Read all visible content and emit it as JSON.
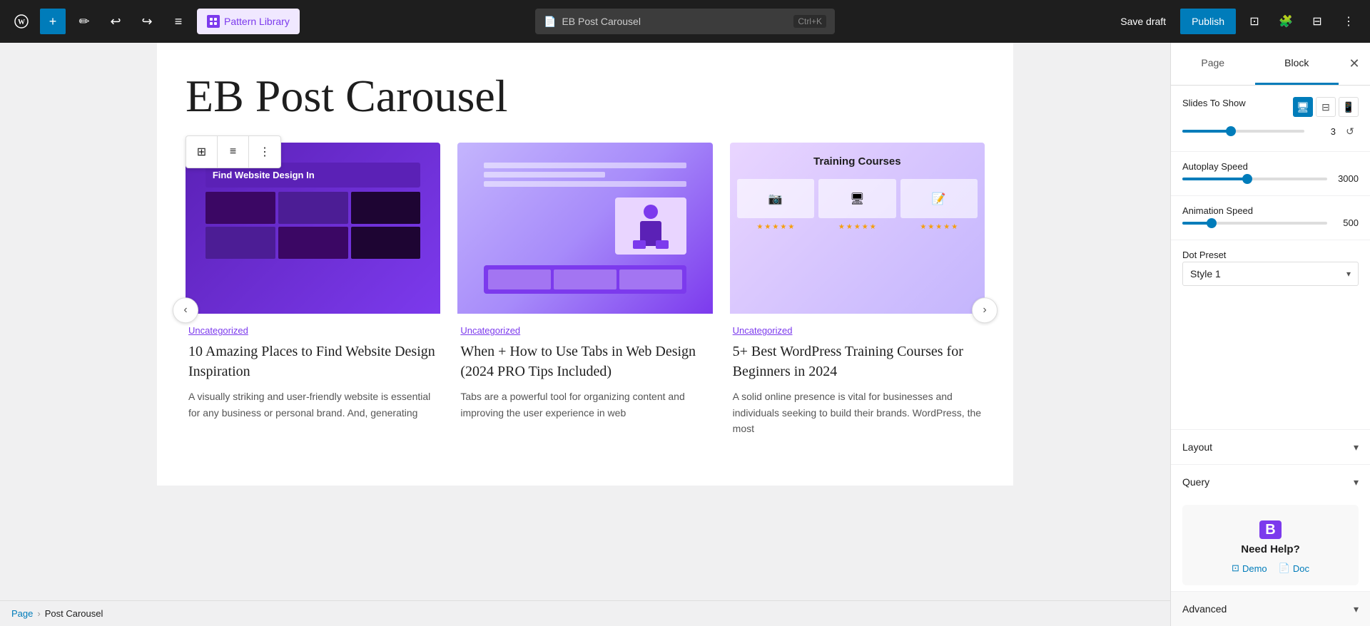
{
  "topbar": {
    "wp_logo": "W",
    "add_label": "+",
    "edit_icon": "✏",
    "undo_icon": "↩",
    "redo_icon": "↪",
    "menu_icon": "≡",
    "pattern_library_label": "Pattern Library",
    "pattern_library_icon": "B",
    "search_placeholder": "EB Post Carousel",
    "search_shortcut": "Ctrl+K",
    "save_draft_label": "Save draft",
    "publish_label": "Publish",
    "view_icon": "⊡",
    "settings_icon": "⊟",
    "puzzle_icon": "⊞",
    "more_icon": "⋮"
  },
  "editor": {
    "page_title": "EB Post Carousel",
    "block_toolbar": {
      "grid_icon": "⊞",
      "list_icon": "≡",
      "more_icon": "⋮"
    }
  },
  "carousel": {
    "prev_icon": "‹",
    "next_icon": "›",
    "cards": [
      {
        "category": "Uncategorized",
        "title": "10 Amazing Places to Find Website Design Inspiration",
        "excerpt": "A visually striking and user-friendly website is essential for any business or personal brand. And, generating",
        "card_label": "Find Website Design In"
      },
      {
        "category": "Uncategorized",
        "title": "When + How to Use Tabs in Web Design (2024 PRO Tips Included)",
        "excerpt": "Tabs are a powerful tool for organizing content and improving the user experience in web"
      },
      {
        "category": "Uncategorized",
        "title": "5+ Best WordPress Training Courses for Beginners in 2024",
        "excerpt": "A solid online presence is vital for businesses and individuals seeking to build their brands. WordPress, the most",
        "card3_title": "Training Courses"
      }
    ]
  },
  "breadcrumb": {
    "page_label": "Page",
    "sep": "›",
    "current": "Post Carousel"
  },
  "sidebar": {
    "page_tab": "Page",
    "block_tab": "Block",
    "close_icon": "✕",
    "slides_to_show_label": "Slides To Show",
    "slides_to_show_value": "3",
    "slides_slider_percent": 40,
    "autoplay_speed_label": "Autoplay Speed",
    "autoplay_speed_value": "3000",
    "autoplay_slider_percent": 45,
    "animation_speed_label": "Animation Speed",
    "animation_speed_value": "500",
    "animation_slider_percent": 20,
    "dot_preset_label": "Dot Preset",
    "dot_preset_value": "Style 1",
    "dot_preset_chevron": "▾",
    "layout_label": "Layout",
    "layout_chevron": "▾",
    "query_label": "Query",
    "query_chevron": "▾",
    "need_help_logo": "B",
    "need_help_title": "Need Help?",
    "demo_label": "Demo",
    "doc_label": "Doc",
    "demo_icon": "⊡",
    "doc_icon": "📄",
    "advanced_label": "Advanced",
    "advanced_chevron": "▾"
  }
}
